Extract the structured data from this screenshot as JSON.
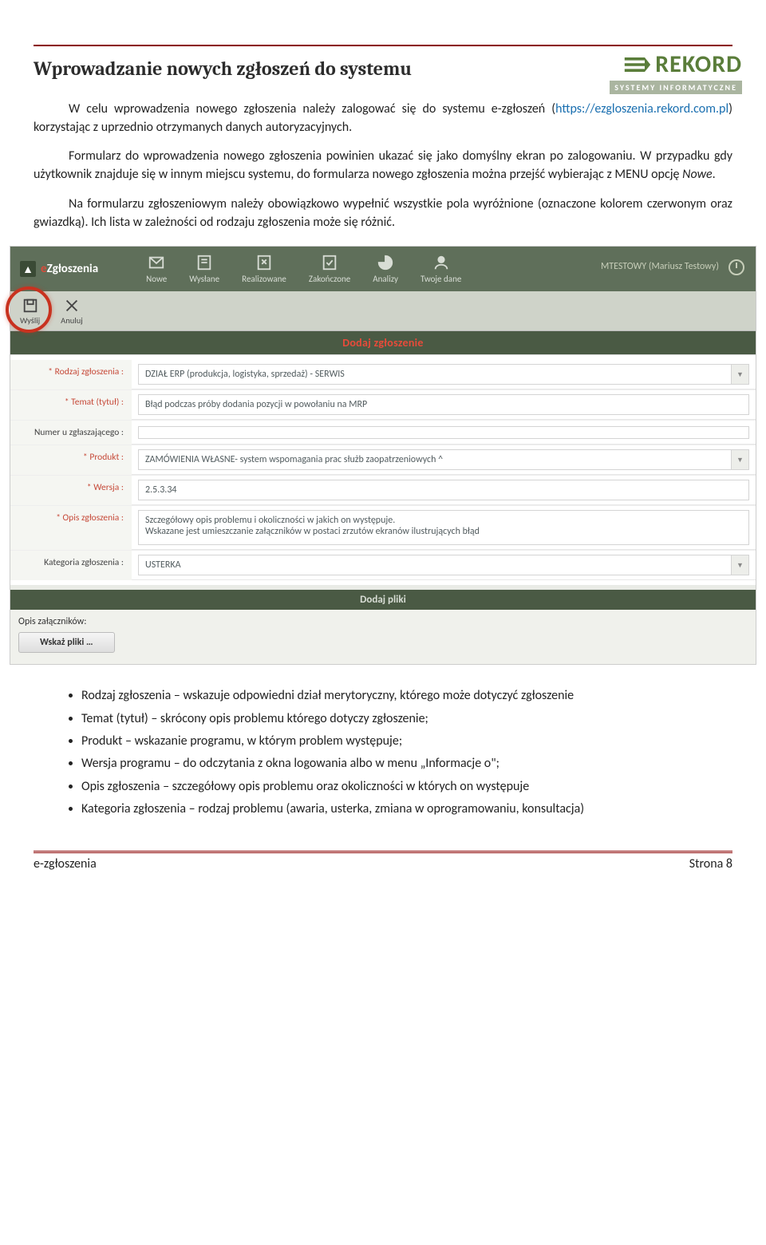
{
  "logo": {
    "name": "REKORD",
    "sub": "SYSTEMY INFORMATYCZNE"
  },
  "heading": "Wprowadzanie nowych zgłoszeń do systemu",
  "para1_a": "W celu wprowadzenia nowego zgłoszenia należy zalogować się do systemu e-zgłoszeń (",
  "para1_link": "https://ezgloszenia.rekord.com.pl",
  "para1_b": ") korzystając z uprzednio otrzymanych danych autoryzacyjnych.",
  "para2": "Formularz do wprowadzenia nowego zgłoszenia powinien ukazać się jako domyślny ekran po zalogowaniu. W przypadku gdy użytkownik znajduje się w innym miejscu systemu, do formularza nowego zgłoszenia można przejść wybierając z MENU opcję ",
  "para2_em": "Nowe",
  "para2_end": ".",
  "para3": "Na formularzu zgłoszeniowym należy obowiązkowo wypełnić wszystkie pola wyróżnione (oznaczone kolorem czerwonym oraz gwiazdką). Ich lista w zależności od rodzaju zgłoszenia może się różnić.",
  "screenshot": {
    "brand_e": "e",
    "brand_rest": "Zgłoszenia",
    "nav": [
      "Nowe",
      "Wysłane",
      "Realizowane",
      "Zakończone",
      "Analizy",
      "Twoje dane"
    ],
    "user": "MTESTOWY (Mariusz Testowy)",
    "actions": {
      "send": "Wyślij",
      "cancel": "Anuluj"
    },
    "form_title_pre": "Dodaj ",
    "form_title_red": "zgłoszenie",
    "rows": {
      "rodzaj": {
        "label": "* Rodzaj zgłoszenia :",
        "value": "DZIAŁ ERP (produkcja, logistyka, sprzedaż) - SERWIS"
      },
      "temat": {
        "label": "* Temat (tytuł) :",
        "value": "Błąd podczas próby dodania pozycji w powołaniu na MRP"
      },
      "numer": {
        "label": "Numer u zgłaszającego :",
        "value": ""
      },
      "produkt": {
        "label": "* Produkt :",
        "value": "ZAMÓWIENIA WŁASNE- system wspomagania prac służb zaopatrzeniowych ^"
      },
      "wersja": {
        "label": "* Wersja :",
        "value": "2.5.3.34"
      },
      "opis": {
        "label": "* Opis zgłoszenia :",
        "value": "Szczegółowy opis problemu i okoliczności w jakich on występuje.\nWskazane jest umieszczanie załączników w postaci zrzutów ekranów ilustrujących błąd"
      },
      "kategoria": {
        "label": "Kategoria zgłoszenia :",
        "value": "USTERKA"
      }
    },
    "files_title": "Dodaj pliki",
    "files_label": "Opis załączników:",
    "files_button": "Wskaż pliki …"
  },
  "bullets": [
    "Rodzaj zgłoszenia – wskazuje odpowiedni dział merytoryczny, którego może dotyczyć zgłoszenie",
    "Temat (tytuł) – skrócony opis problemu którego dotyczy zgłoszenie;",
    "Produkt – wskazanie programu, w którym problem występuje;",
    "Wersja programu – do odczytania z okna logowania albo w menu „Informacje o\";",
    "Opis zgłoszenia – szczegółowy opis problemu oraz okoliczności w których on występuje",
    "Kategoria zgłoszenia – rodzaj problemu (awaria, usterka, zmiana w oprogramowaniu, konsultacja)"
  ],
  "footer": {
    "left": "e-zgłoszenia",
    "right": "Strona 8"
  }
}
